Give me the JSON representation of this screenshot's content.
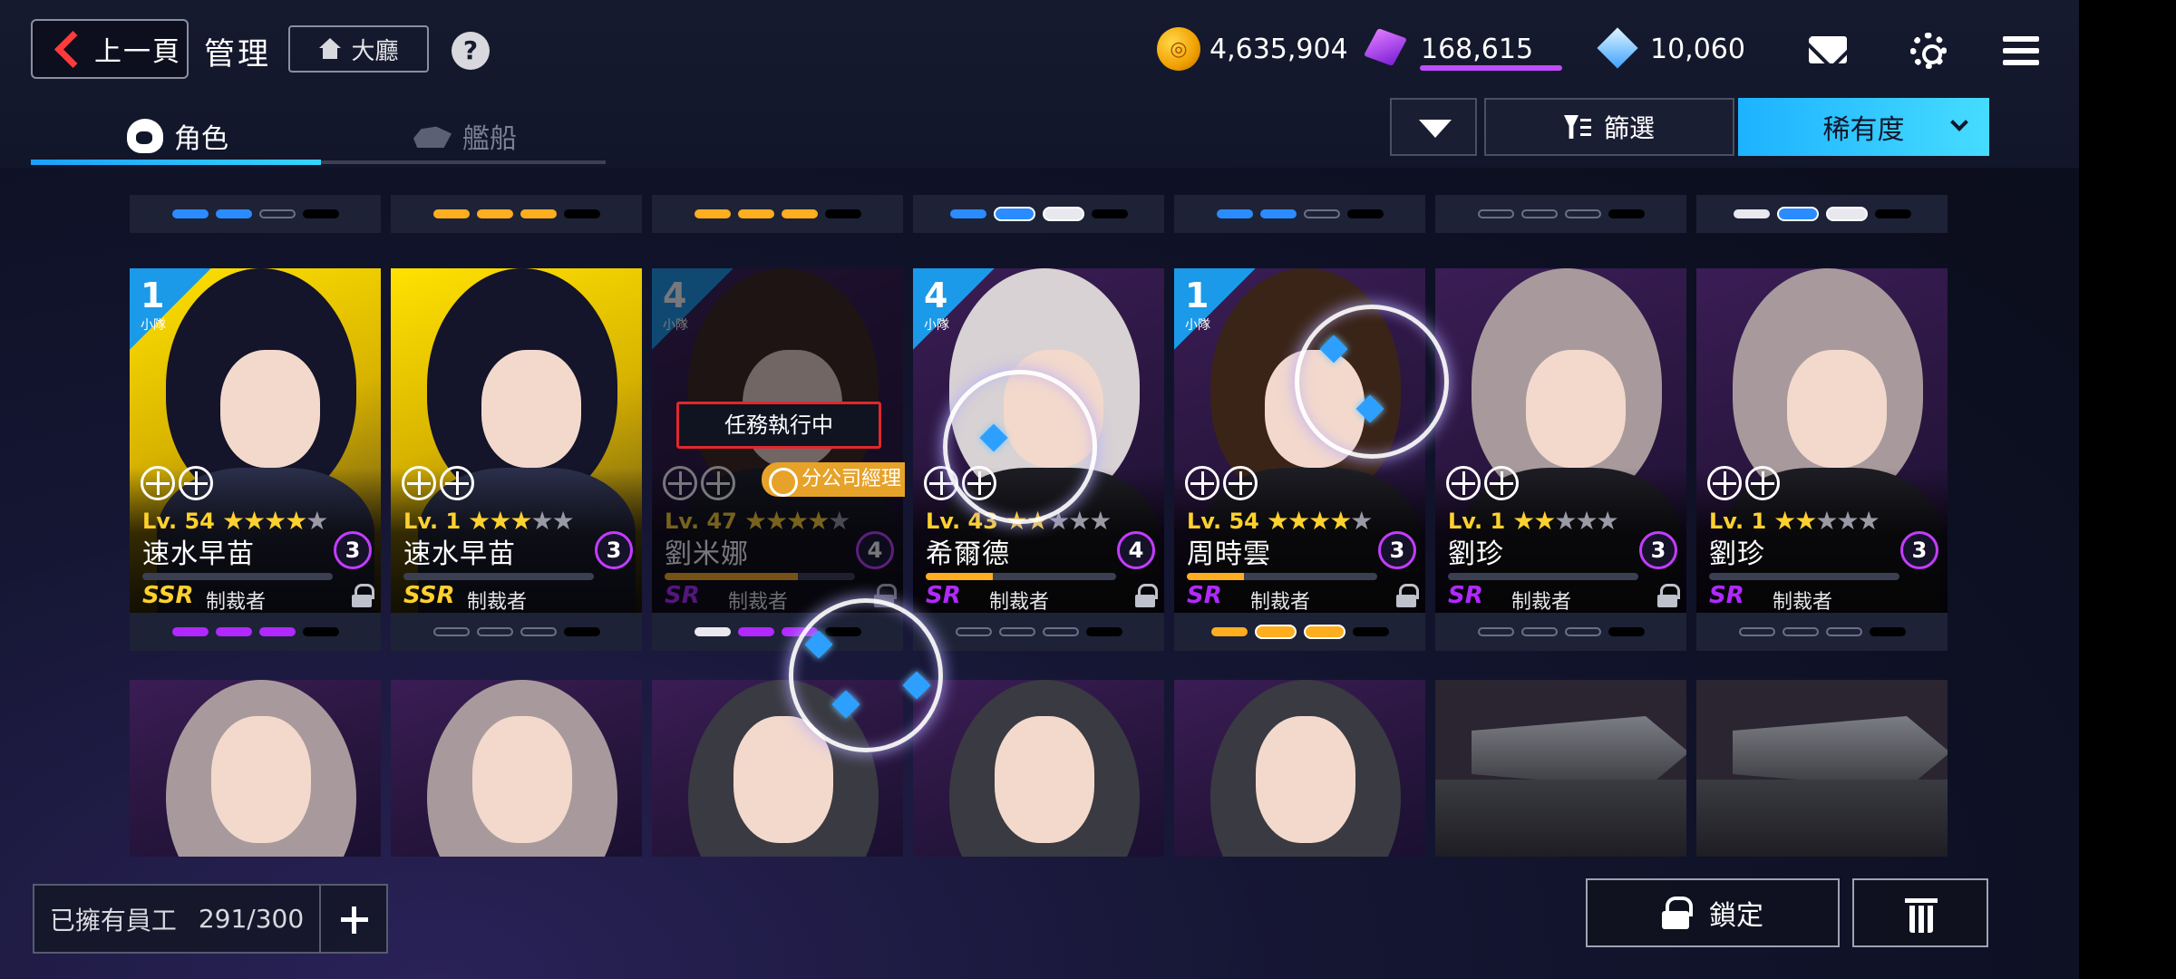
{
  "topbar": {
    "back_label": "上一頁",
    "title": "管理",
    "lobby_label": "大廳",
    "help_label": "?"
  },
  "currencies": {
    "gold": "4,635,904",
    "cubes": "168,615",
    "crystals": "10,060"
  },
  "tabs": [
    {
      "label": "角色",
      "active": true
    },
    {
      "label": "艦船",
      "active": false
    }
  ],
  "toolbar": {
    "filter_label": "篩選",
    "sort_label": "稀有度"
  },
  "row0_pips": [
    [
      "blue",
      "blue",
      "off",
      "black"
    ],
    [
      "orange",
      "orange",
      "orange",
      "black"
    ],
    [
      "orange",
      "orange",
      "orange",
      "black"
    ],
    [
      "blue",
      "blue-big",
      "white-big",
      "black"
    ],
    [
      "blue",
      "blue",
      "off",
      "black"
    ],
    [
      "off",
      "off",
      "off",
      "black"
    ],
    [
      "white",
      "blue-big",
      "white-big",
      "black"
    ]
  ],
  "cards": [
    {
      "squad": "1",
      "squad_label": "小隊",
      "level": "Lv. 54",
      "stars": 4,
      "name": "速水早苗",
      "limit": "3",
      "rarity": "SSR",
      "cls": "制裁者",
      "xp": 0.0,
      "bg": "yellow",
      "hair": "black",
      "pips": [
        "purple",
        "purple",
        "purple",
        "black"
      ],
      "locked": true
    },
    {
      "squad": "",
      "squad_label": "",
      "level": "Lv. 1",
      "stars": 3,
      "name": "速水早苗",
      "limit": "3",
      "rarity": "SSR",
      "cls": "制裁者",
      "xp": 0.0,
      "bg": "yellow",
      "hair": "black",
      "pips": [
        "off",
        "off",
        "off",
        "black"
      ],
      "locked": false
    },
    {
      "squad": "4",
      "squad_label": "小隊",
      "level": "Lv. 47",
      "stars": 4,
      "name": "劉米娜",
      "limit": "4",
      "rarity": "SR",
      "cls": "制裁者",
      "xp": 0.7,
      "bg": "purple",
      "hair": "brown",
      "pips": [
        "white",
        "purple",
        "purple",
        "black"
      ],
      "locked": true,
      "mission": "任務執行中",
      "manager": "分公司經理"
    },
    {
      "squad": "4",
      "squad_label": "小隊",
      "level": "Lv. 43",
      "stars": 2,
      "name": "希爾德",
      "limit": "4",
      "rarity": "SR",
      "cls": "制裁者",
      "xp": 0.35,
      "bg": "purple",
      "hair": "silver",
      "pips": [
        "off",
        "off",
        "off",
        "black"
      ],
      "locked": true
    },
    {
      "squad": "1",
      "squad_label": "小隊",
      "level": "Lv. 54",
      "stars": 4,
      "name": "周時雲",
      "limit": "3",
      "rarity": "SR",
      "cls": "制裁者",
      "xp": 0.3,
      "bg": "purple",
      "hair": "brown",
      "pips": [
        "orange",
        "orange-big",
        "orange-big",
        "black"
      ],
      "locked": true
    },
    {
      "squad": "",
      "squad_label": "",
      "level": "Lv. 1",
      "stars": 2,
      "name": "劉珍",
      "limit": "3",
      "rarity": "SR",
      "cls": "制裁者",
      "xp": 0.0,
      "bg": "purple",
      "hair": "gray",
      "pips": [
        "off",
        "off",
        "off",
        "black"
      ],
      "locked": true
    },
    {
      "squad": "",
      "squad_label": "",
      "level": "Lv. 1",
      "stars": 2,
      "name": "劉珍",
      "limit": "3",
      "rarity": "SR",
      "cls": "制裁者",
      "xp": 0.0,
      "bg": "purple",
      "hair": "gray",
      "pips": [
        "off",
        "off",
        "off",
        "black"
      ],
      "locked": false
    }
  ],
  "footer": {
    "owned_label": "已擁有員工",
    "owned_count": "291/300",
    "lock_label": "鎖定"
  },
  "colors": {
    "accent_cyan": "#1db2ff",
    "ssr_gold": "#ffd12e",
    "sr_purple": "#b129ff",
    "mission_red": "#e0272f",
    "manager_orange": "#e6a229"
  },
  "icons": [
    "back-chevron-icon",
    "house-icon",
    "help-icon",
    "gold-coin-icon",
    "purple-cube-icon",
    "blue-crystal-icon",
    "mail-icon",
    "gear-icon",
    "menu-icon",
    "character-tab-icon",
    "ship-tab-icon",
    "dropdown-triangle-icon",
    "filter-icon",
    "chevron-down-icon",
    "lock-icon",
    "trash-icon",
    "plus-icon"
  ]
}
